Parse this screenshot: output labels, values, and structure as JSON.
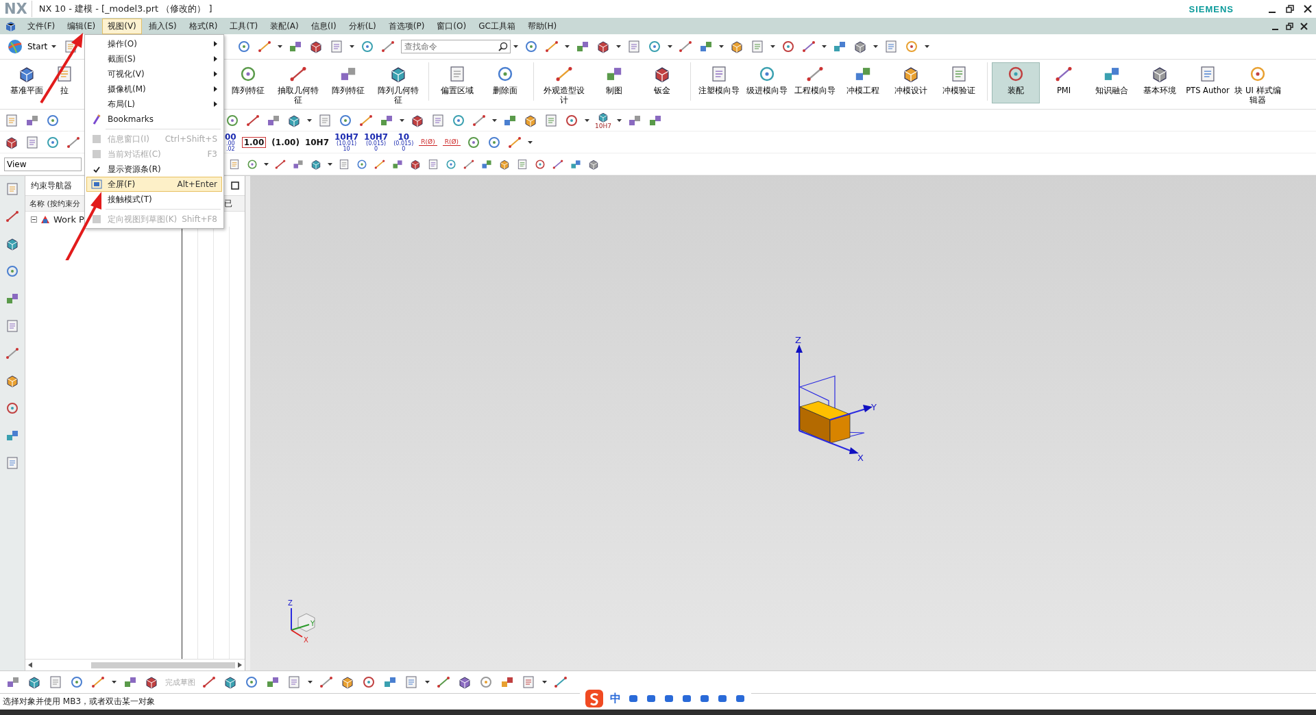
{
  "title_bar": {
    "logo": "NX",
    "title": "NX 10 - 建模 - [_model3.prt （修改的） ]",
    "brand": "SIEMENS"
  },
  "menu_bar": {
    "items": [
      {
        "label": "文件(F)",
        "selected": false
      },
      {
        "label": "编辑(E)",
        "selected": false
      },
      {
        "label": "视图(V)",
        "selected": true
      },
      {
        "label": "插入(S)",
        "selected": false
      },
      {
        "label": "格式(R)",
        "selected": false
      },
      {
        "label": "工具(T)",
        "selected": false
      },
      {
        "label": "装配(A)",
        "selected": false
      },
      {
        "label": "信息(I)",
        "selected": false
      },
      {
        "label": "分析(L)",
        "selected": false
      },
      {
        "label": "首选项(P)",
        "selected": false
      },
      {
        "label": "窗口(O)",
        "selected": false
      },
      {
        "label": "GC工具箱",
        "selected": false
      },
      {
        "label": "帮助(H)",
        "selected": false
      }
    ]
  },
  "start_button": "Start",
  "command_search": {
    "placeholder": "查找命令"
  },
  "ribbon": {
    "buttons": [
      {
        "label": "基准平面",
        "selected": false
      },
      {
        "label": "拉",
        "selected": false
      },
      {
        "label": "阵列特征",
        "selected": false
      },
      {
        "label": "抽取几何特征",
        "selected": false
      },
      {
        "label": "阵列特征",
        "selected": false
      },
      {
        "label": "阵列几何特征",
        "selected": false
      },
      {
        "label": "偏置区域",
        "selected": false
      },
      {
        "label": "删除面",
        "selected": false
      },
      {
        "label": "外观造型设计",
        "selected": false
      },
      {
        "label": "制图",
        "selected": false
      },
      {
        "label": "钣金",
        "selected": false
      },
      {
        "label": "注塑模向导",
        "selected": false
      },
      {
        "label": "级进模向导",
        "selected": false
      },
      {
        "label": "工程模向导",
        "selected": false
      },
      {
        "label": "冲模工程",
        "selected": false
      },
      {
        "label": "冲模设计",
        "selected": false
      },
      {
        "label": "冲模验证",
        "selected": false
      },
      {
        "label": "装配",
        "selected": true
      },
      {
        "label": "PMI",
        "selected": false
      },
      {
        "label": "知识融合",
        "selected": false
      },
      {
        "label": "基本环境",
        "selected": false
      },
      {
        "label": "PTS Author",
        "selected": false
      },
      {
        "label": "块 UI 样式编辑器",
        "selected": false
      }
    ]
  },
  "measure_toolbar": {
    "tolerance_label": "10H7"
  },
  "dimension_toolbar": [
    {
      "kind": "stacked",
      "main": "00",
      "sub": [
        ".00",
        ".02"
      ]
    },
    {
      "kind": "boxed",
      "main": "1.00"
    },
    {
      "kind": "plain",
      "main": "(1.00)"
    },
    {
      "kind": "plain",
      "main": "10H7"
    },
    {
      "kind": "stacked",
      "main": "10H7",
      "sub": [
        "(10.01)",
        "10"
      ]
    },
    {
      "kind": "stacked",
      "main": "10H7",
      "sub": [
        "(0.015)",
        "0"
      ]
    },
    {
      "kind": "stacked",
      "main": "10",
      "sub": [
        "(0.015)",
        "0"
      ]
    },
    {
      "kind": "radius",
      "main": "R(Ø)"
    },
    {
      "kind": "radius",
      "main": "R(Ø)"
    }
  ],
  "view_field": {
    "value": "View"
  },
  "view_menu": {
    "items": [
      {
        "kind": "submenu",
        "label": "操作(O)",
        "disabled": false,
        "checked": false,
        "selected": false
      },
      {
        "kind": "submenu",
        "label": "截面(S)",
        "disabled": false,
        "checked": false,
        "selected": false
      },
      {
        "kind": "submenu",
        "label": "可视化(V)",
        "disabled": false,
        "checked": false,
        "selected": false
      },
      {
        "kind": "submenu",
        "label": "摄像机(M)",
        "disabled": false,
        "checked": false,
        "selected": false
      },
      {
        "kind": "submenu",
        "label": "布局(L)",
        "disabled": false,
        "checked": false,
        "selected": false
      },
      {
        "kind": "item",
        "label": "Bookmarks",
        "disabled": false,
        "checked": false,
        "selected": false
      },
      {
        "kind": "separator"
      },
      {
        "kind": "item",
        "label": "信息窗口(I)",
        "shortcut": "Ctrl+Shift+S",
        "disabled": true,
        "checked": false,
        "selected": false
      },
      {
        "kind": "item",
        "label": "当前对话框(C)",
        "shortcut": "F3",
        "disabled": true,
        "checked": false,
        "selected": false
      },
      {
        "kind": "item",
        "label": "显示资源条(R)",
        "disabled": false,
        "checked": true,
        "selected": false
      },
      {
        "kind": "item",
        "label": "全屏(F)",
        "shortcut": "Alt+Enter",
        "disabled": false,
        "checked": false,
        "selected": true
      },
      {
        "kind": "item",
        "label": "接触模式(T)",
        "disabled": false,
        "checked": false,
        "selected": false
      },
      {
        "kind": "separator"
      },
      {
        "kind": "item",
        "label": "定向视图到草图(K)",
        "shortcut": "Shift+F8",
        "disabled": true,
        "checked": false,
        "selected": false
      }
    ]
  },
  "navigator": {
    "title": "约束导航器",
    "columns": [
      "名称 (按约束分",
      "已"
    ],
    "tree": [
      {
        "label": "Work P",
        "expanded": true
      }
    ]
  },
  "viewport": {
    "axes": [
      "Z",
      "Y",
      "X"
    ],
    "triad": [
      "Z",
      "Y",
      "X"
    ]
  },
  "sketch_toolbar": {
    "finish_label": "完成草图",
    "finish_disabled": true
  },
  "status_bar": {
    "text": "选择对象并使用 MB3，或者双击某一对象"
  },
  "ime_bar": {
    "mode": "中"
  }
}
